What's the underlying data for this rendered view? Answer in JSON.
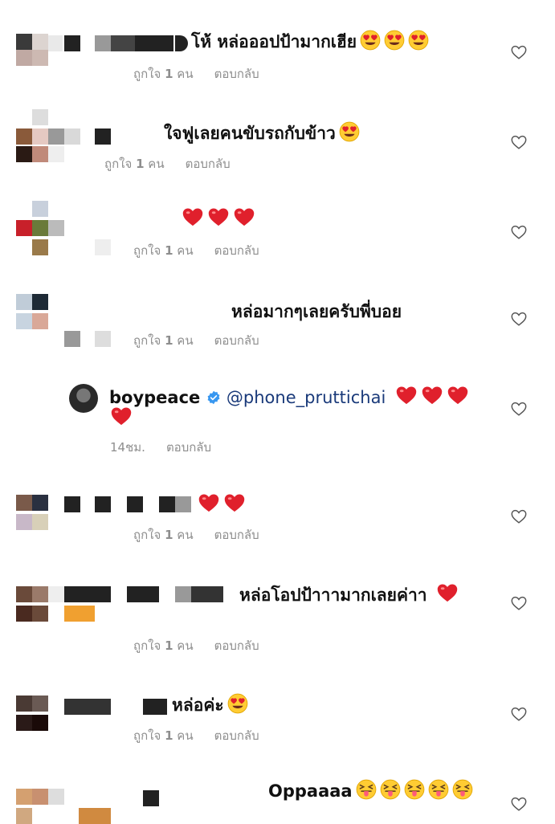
{
  "like_word": "ถูกใจ",
  "like_count": "1",
  "like_unit": "คน",
  "reply_label": "ตอบกลับ",
  "comments": [
    {
      "text": "โห้ หล่อออปป้ามากเฮีย",
      "emoji": [
        "heart-eyes",
        "heart-eyes",
        "heart-eyes"
      ]
    },
    {
      "text": "ใจฟูเลยคนขับรถกับข้าว",
      "emoji": [
        "heart-eyes"
      ]
    },
    {
      "text": "",
      "emoji": [
        "red-heart",
        "red-heart",
        "red-heart"
      ]
    },
    {
      "text": "หล่อมากๆเลยครับพี่บอย",
      "emoji": []
    },
    {
      "text": "",
      "emoji": [
        "red-heart",
        "red-heart"
      ]
    },
    {
      "text": "หล่อโอปป้าาามากเลยค่าา",
      "emoji": [
        "red-heart"
      ]
    },
    {
      "text": "หล่อค่ะ",
      "emoji": [
        "heart-eyes"
      ]
    },
    {
      "text": "Oppaaaa",
      "emoji": [
        "squint-tongue",
        "squint-tongue",
        "squint-tongue",
        "squint-tongue",
        "squint-tongue"
      ]
    }
  ],
  "reply": {
    "username": "boypeace",
    "mention": "@phone_pruttichai",
    "time": "14ชม.",
    "emoji": [
      "red-heart",
      "red-heart",
      "red-heart",
      "red-heart"
    ]
  },
  "icons": {
    "like": "heart-outline-icon",
    "verified": "verified-badge-icon"
  },
  "colors": {
    "meta": "#8e8e8e",
    "heart": "#e0202c",
    "verified": "#3897f0"
  }
}
